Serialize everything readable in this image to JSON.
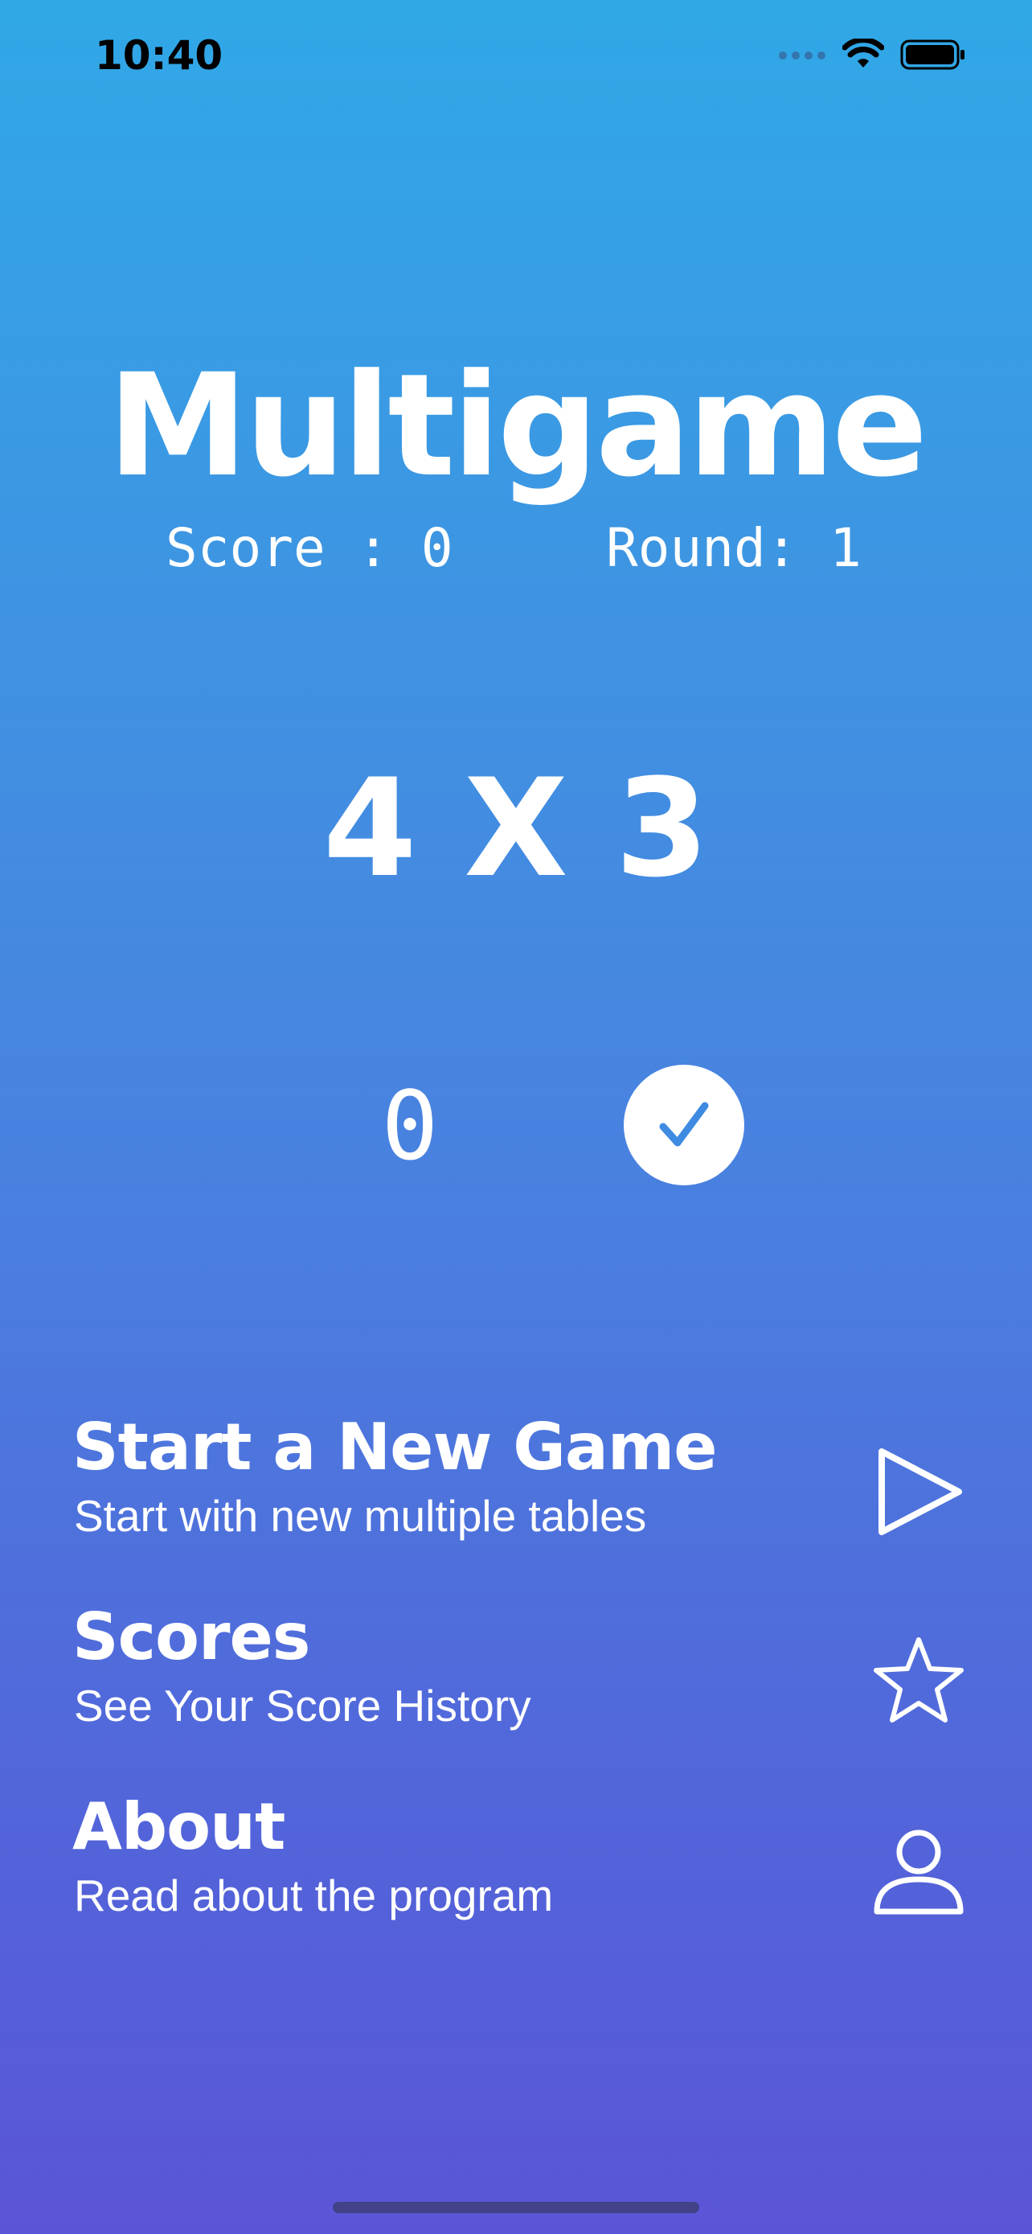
{
  "status_bar": {
    "time": "10:40",
    "icons": [
      "cellular-dots-icon",
      "wifi-icon",
      "battery-icon"
    ]
  },
  "game": {
    "title": "Multigame",
    "score_label": "Score : 0",
    "round_label": "Round: 1",
    "question": "4 X 3",
    "answer_value": "0",
    "submit_icon": "checkmark-icon"
  },
  "menu": {
    "items": [
      {
        "title": "Start a New Game",
        "subtitle": "Start with new multiple tables",
        "icon": "play-icon"
      },
      {
        "title": "Scores",
        "subtitle": "See Your Score History",
        "icon": "star-icon"
      },
      {
        "title": "About",
        "subtitle": "Read about the program",
        "icon": "person-icon"
      }
    ]
  },
  "colors": {
    "gradient_top": "#30a8e6",
    "gradient_bottom": "#5a55d6",
    "text": "#ffffff",
    "check_blue": "#3f8be2"
  }
}
